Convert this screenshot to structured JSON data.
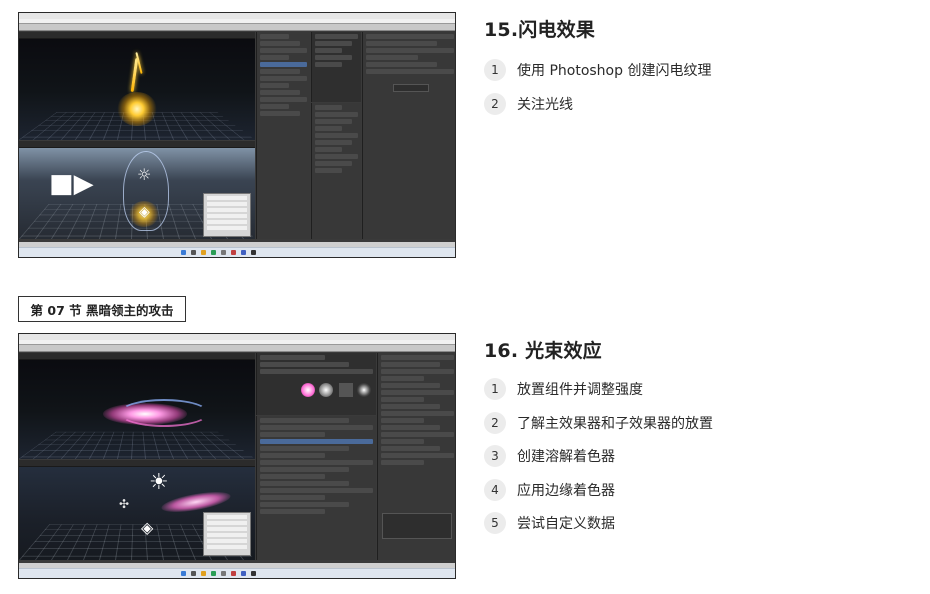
{
  "sections": [
    {
      "title": "15.闪电效果",
      "steps": [
        {
          "num": "1",
          "text": "使用 Photoshop 创建闪电纹理"
        },
        {
          "num": "2",
          "text": "关注光线"
        }
      ]
    },
    {
      "title": "16. 光束效应",
      "steps": [
        {
          "num": "1",
          "text": "放置组件并调整强度"
        },
        {
          "num": "2",
          "text": "了解主效果器和子效果器的放置"
        },
        {
          "num": "3",
          "text": "创建溶解着色器"
        },
        {
          "num": "4",
          "text": "应用边缘着色器"
        },
        {
          "num": "5",
          "text": "尝试自定义数据"
        }
      ]
    }
  ],
  "chapter": {
    "label": "第 07 节 黑暗领主的攻击"
  },
  "screenshots": [
    {
      "subject": "unity-editor-lightning-effect"
    },
    {
      "subject": "unity-editor-beam-effect"
    }
  ],
  "colors": {
    "step_badge": "#ececec",
    "editor_dark": "#3a3a3a",
    "lightning_glow": "#ffcc33",
    "beam_pink": "#ff6ad5",
    "beam_blue": "#8fb4ff"
  },
  "icons": [
    "camera-icon",
    "cube-icon",
    "sun-icon",
    "taskbar-app-icon"
  ]
}
